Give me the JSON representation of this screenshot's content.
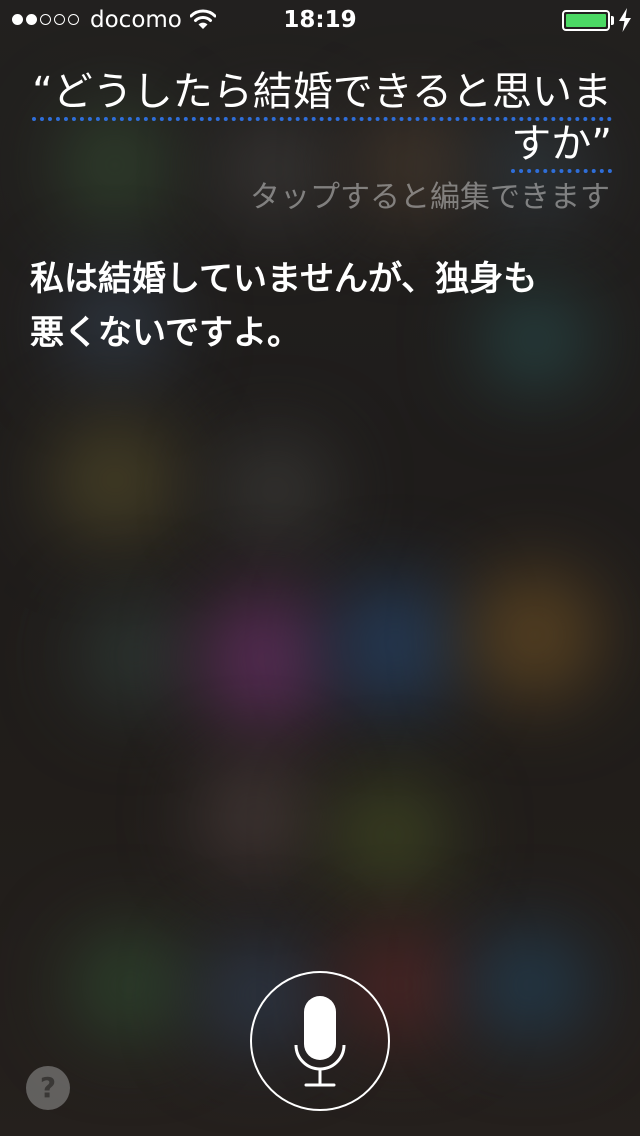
{
  "status_bar": {
    "signal_bars_filled": 2,
    "signal_bars_total": 5,
    "carrier": "docomo",
    "time": "18:19",
    "battery_color": "#4cd964",
    "charging": true
  },
  "siri": {
    "query": "“どうしたら結婚できると思いますか”",
    "tap_to_edit": "タップすると編集できます",
    "answer": "私は結婚していませんが、独身も悪くないですよ。",
    "mic_icon": "microphone-icon",
    "help_label": "?",
    "accent_color": "#2f6ed8"
  }
}
